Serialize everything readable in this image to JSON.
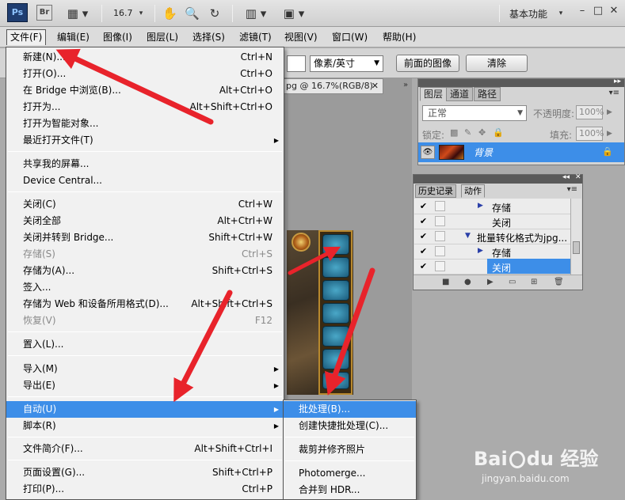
{
  "app": {
    "logo": "Ps",
    "bridge_logo": "Br",
    "zoom_value": "16.7",
    "workspace": "基本功能"
  },
  "menubar": [
    {
      "label": "文件(F)"
    },
    {
      "label": "编辑(E)"
    },
    {
      "label": "图像(I)"
    },
    {
      "label": "图层(L)"
    },
    {
      "label": "选择(S)"
    },
    {
      "label": "滤镜(T)"
    },
    {
      "label": "视图(V)"
    },
    {
      "label": "窗口(W)"
    },
    {
      "label": "帮助(H)"
    }
  ],
  "options_bar": {
    "units_select": "像素/英寸",
    "front_image_button": "前面的图像",
    "clear_button": "清除"
  },
  "document": {
    "tab_title": "pg @ 16.7%(RGB/8)"
  },
  "file_menu": [
    {
      "label": "新建(N)...",
      "shortcut": "Ctrl+N"
    },
    {
      "label": "打开(O)...",
      "shortcut": "Ctrl+O"
    },
    {
      "label": "在 Bridge 中浏览(B)...",
      "shortcut": "Alt+Ctrl+O"
    },
    {
      "label": "打开为...",
      "shortcut": "Alt+Shift+Ctrl+O"
    },
    {
      "label": "打开为智能对象..."
    },
    {
      "label": "最近打开文件(T)"
    },
    {
      "label": "共享我的屏幕..."
    },
    {
      "label": "Device Central..."
    },
    {
      "label": "关闭(C)",
      "shortcut": "Ctrl+W"
    },
    {
      "label": "关闭全部",
      "shortcut": "Alt+Ctrl+W"
    },
    {
      "label": "关闭并转到 Bridge...",
      "shortcut": "Shift+Ctrl+W"
    },
    {
      "label": "存储(S)",
      "shortcut": "Ctrl+S"
    },
    {
      "label": "存储为(A)...",
      "shortcut": "Shift+Ctrl+S"
    },
    {
      "label": "签入..."
    },
    {
      "label": "存储为 Web 和设备所用格式(D)...",
      "shortcut": "Alt+Shift+Ctrl+S"
    },
    {
      "label": "恢复(V)",
      "shortcut": "F12"
    },
    {
      "label": "置入(L)..."
    },
    {
      "label": "导入(M)"
    },
    {
      "label": "导出(E)"
    },
    {
      "label": "自动(U)"
    },
    {
      "label": "脚本(R)"
    },
    {
      "label": "文件简介(F)...",
      "shortcut": "Alt+Shift+Ctrl+I"
    },
    {
      "label": "页面设置(G)...",
      "shortcut": "Shift+Ctrl+P"
    },
    {
      "label": "打印(P)...",
      "shortcut": "Ctrl+P"
    }
  ],
  "automate_submenu": [
    {
      "label": "批处理(B)..."
    },
    {
      "label": "创建快捷批处理(C)..."
    },
    {
      "label": "裁剪并修齐照片"
    },
    {
      "label": "Photomerge..."
    },
    {
      "label": "合并到 HDR..."
    }
  ],
  "layers_panel": {
    "tabs": [
      "图层",
      "通道",
      "路径"
    ],
    "blend_mode": "正常",
    "opacity_label": "不透明度:",
    "opacity_value": "100%",
    "lock_label": "锁定:",
    "fill_label": "填充:",
    "fill_value": "100%",
    "layer_name": "背景"
  },
  "actions_panel": {
    "tabs": [
      "历史记录",
      "动作"
    ],
    "rows": [
      {
        "label": "存储"
      },
      {
        "label": "关闭"
      },
      {
        "label": "批量转化格式为jpg..."
      },
      {
        "label": "存储"
      },
      {
        "label": "关闭"
      }
    ]
  },
  "watermark": {
    "brand": "Bai",
    "brand2": "经验",
    "url": "jingyan.baidu.com"
  },
  "colors": {
    "highlight": "#3d8ee8",
    "arrow": "#e8232b"
  }
}
